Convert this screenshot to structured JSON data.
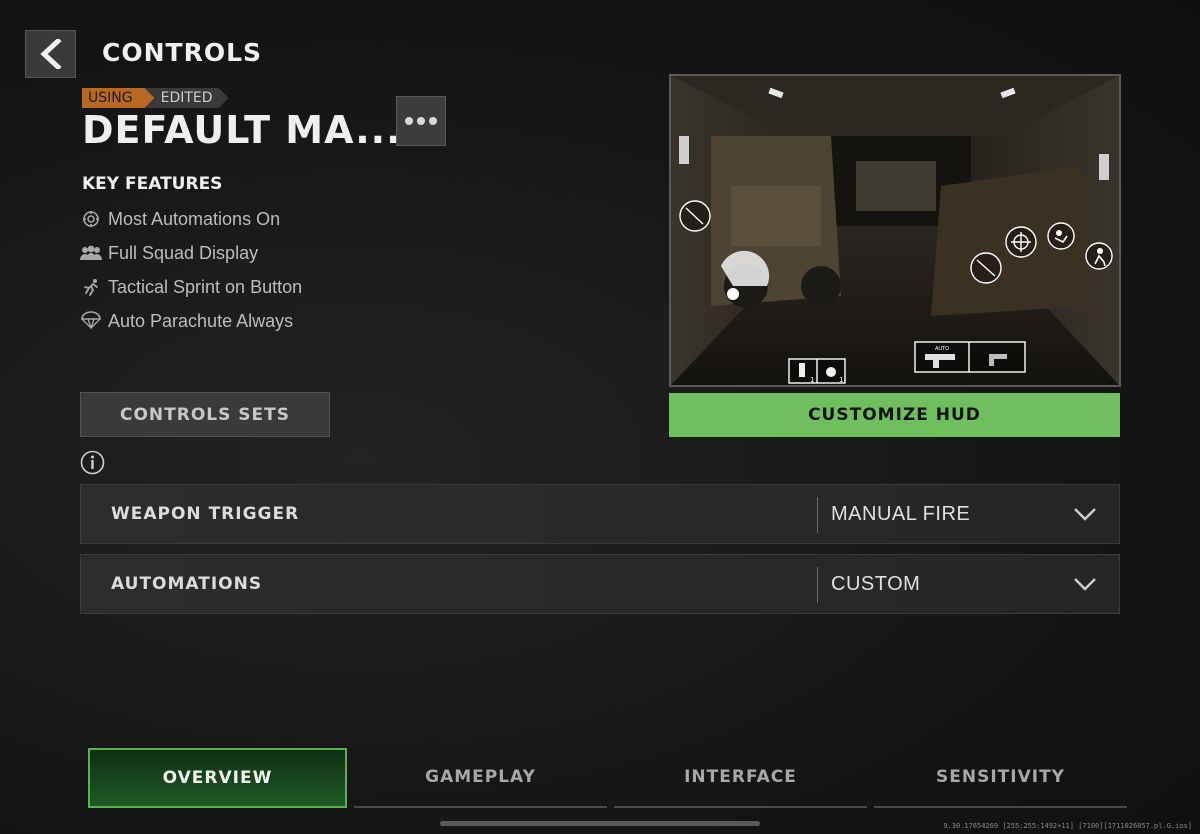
{
  "header": {
    "title": "CONTROLS"
  },
  "preset": {
    "tag_using": "USING",
    "tag_edited": "EDITED",
    "name": "DEFAULT MA..."
  },
  "key_features": {
    "title": "KEY FEATURES",
    "items": [
      {
        "label": "Most Automations On",
        "icon": "automation-icon"
      },
      {
        "label": "Full Squad Display",
        "icon": "squad-icon"
      },
      {
        "label": "Tactical Sprint on Button",
        "icon": "sprint-icon"
      },
      {
        "label": "Auto Parachute Always",
        "icon": "parachute-icon"
      }
    ]
  },
  "buttons": {
    "controls_sets": "CONTROLS SETS",
    "customize_hud": "CUSTOMIZE HUD"
  },
  "preview_hud": {
    "weapon_tag": "AUTO",
    "grenade_counts": [
      "1",
      "1"
    ]
  },
  "settings": [
    {
      "label": "WEAPON TRIGGER",
      "value": "MANUAL FIRE"
    },
    {
      "label": "AUTOMATIONS",
      "value": "CUSTOM"
    }
  ],
  "tabs": [
    {
      "label": "OVERVIEW",
      "active": true
    },
    {
      "label": "GAMEPLAY",
      "active": false
    },
    {
      "label": "INTERFACE",
      "active": false
    },
    {
      "label": "SENSITIVITY",
      "active": false
    }
  ],
  "build_info": "9.30.17654269 [255:255:1492+11] [7100][1711026057.pl.G.ios]",
  "colors": {
    "accent_green": "#6fbf5f",
    "using_orange": "#b8691f"
  }
}
